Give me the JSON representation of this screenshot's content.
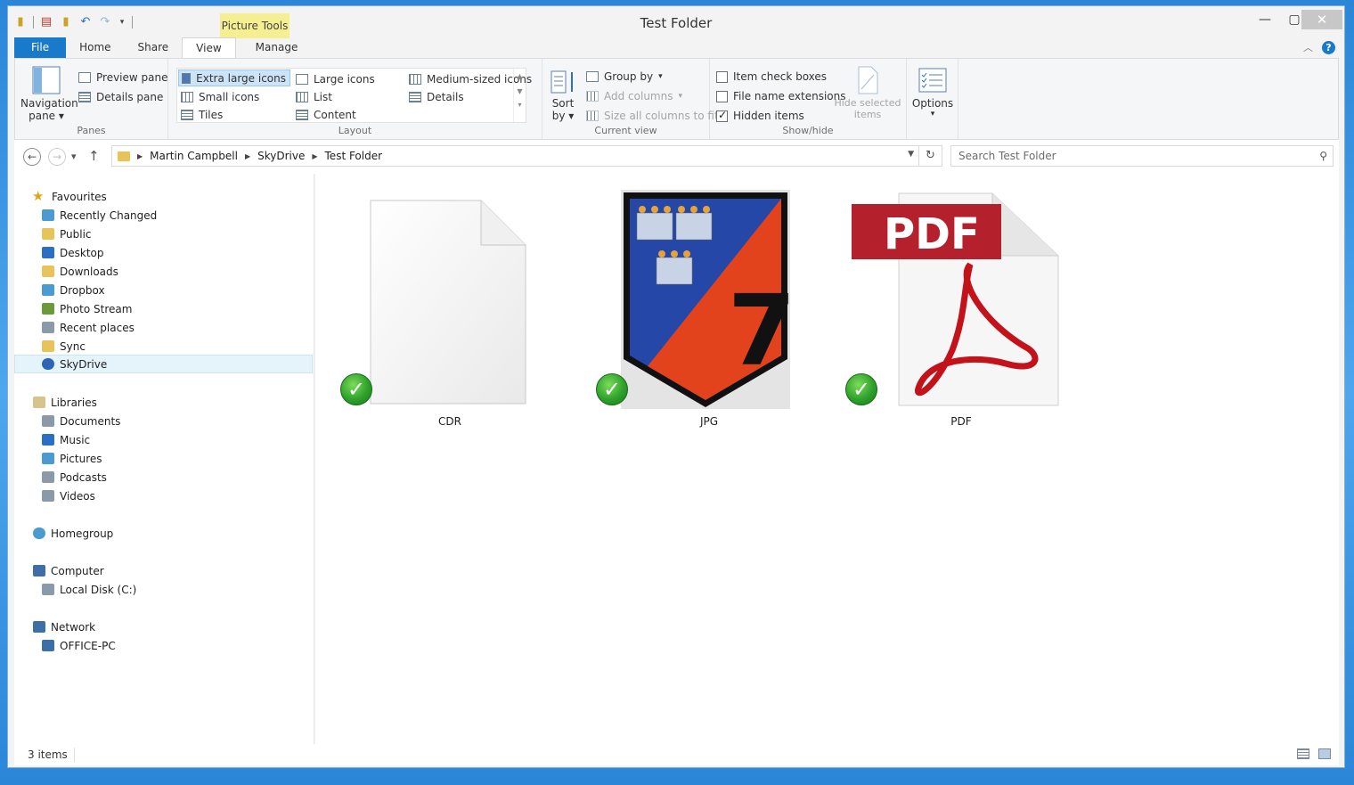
{
  "window": {
    "title": "Test Folder",
    "contextual_tab_group": "Picture Tools",
    "controls": {
      "minimize": "—",
      "maximize": "▢",
      "close": "✕"
    }
  },
  "ribbon_tabs": [
    {
      "label": "File",
      "selected": false
    },
    {
      "label": "Home",
      "selected": false
    },
    {
      "label": "Share",
      "selected": false
    },
    {
      "label": "View",
      "selected": true
    },
    {
      "label": "Manage",
      "selected": false
    }
  ],
  "ribbon": {
    "panes": {
      "label": "Panes",
      "navigation_pane_line1": "Navigation",
      "navigation_pane_line2": "pane",
      "preview_pane": "Preview pane",
      "details_pane": "Details pane"
    },
    "layout": {
      "label": "Layout",
      "items": [
        "Extra large icons",
        "Large icons",
        "Medium-sized icons",
        "Small icons",
        "List",
        "Details",
        "Tiles",
        "Content"
      ],
      "selected": "Extra large icons"
    },
    "current_view": {
      "label": "Current view",
      "sort_by_line1": "Sort",
      "sort_by_line2": "by",
      "group_by": "Group by",
      "add_columns": "Add columns",
      "size_all_columns": "Size all columns to fit"
    },
    "show_hide": {
      "label": "Show/hide",
      "item_check_boxes": "Item check boxes",
      "file_name_extensions": "File name extensions",
      "hidden_items": "Hidden items",
      "hide_selected_line1": "Hide selected",
      "hide_selected_line2": "items",
      "checked": {
        "item_check_boxes": false,
        "file_name_extensions": false,
        "hidden_items": true
      }
    },
    "options": {
      "label": "Options"
    }
  },
  "address_bar": {
    "breadcrumbs": [
      "Martin Campbell",
      "SkyDrive",
      "Test Folder"
    ],
    "search_placeholder": "Search Test Folder"
  },
  "nav_pane": {
    "favourites": {
      "label": "Favourites",
      "items": [
        "Recently Changed",
        "Public",
        "Desktop",
        "Downloads",
        "Dropbox",
        "Photo Stream",
        "Recent places",
        "Sync",
        "SkyDrive"
      ],
      "selected": "SkyDrive"
    },
    "libraries": {
      "label": "Libraries",
      "items": [
        "Documents",
        "Music",
        "Pictures",
        "Podcasts",
        "Videos"
      ]
    },
    "homegroup": {
      "label": "Homegroup"
    },
    "computer": {
      "label": "Computer",
      "items": [
        "Local Disk (C:)"
      ]
    },
    "network": {
      "label": "Network",
      "items": [
        "OFFICE-PC"
      ]
    }
  },
  "files": [
    {
      "name": "CDR",
      "kind": "blank-document-icon",
      "synced": true
    },
    {
      "name": "JPG",
      "kind": "shield-image-thumbnail",
      "synced": true,
      "badge_number": "7"
    },
    {
      "name": "PDF",
      "kind": "pdf-document-icon",
      "synced": true,
      "badge_text": "PDF"
    }
  ],
  "status_bar": {
    "item_count": "3 items"
  },
  "colors": {
    "accent_blue": "#1979ca",
    "contextual_yellow": "#f5ef91",
    "pdf_red": "#b5202d",
    "shield_orange": "#e2431c",
    "shield_blue": "#2447a8",
    "sync_green": "#2ea12b"
  }
}
